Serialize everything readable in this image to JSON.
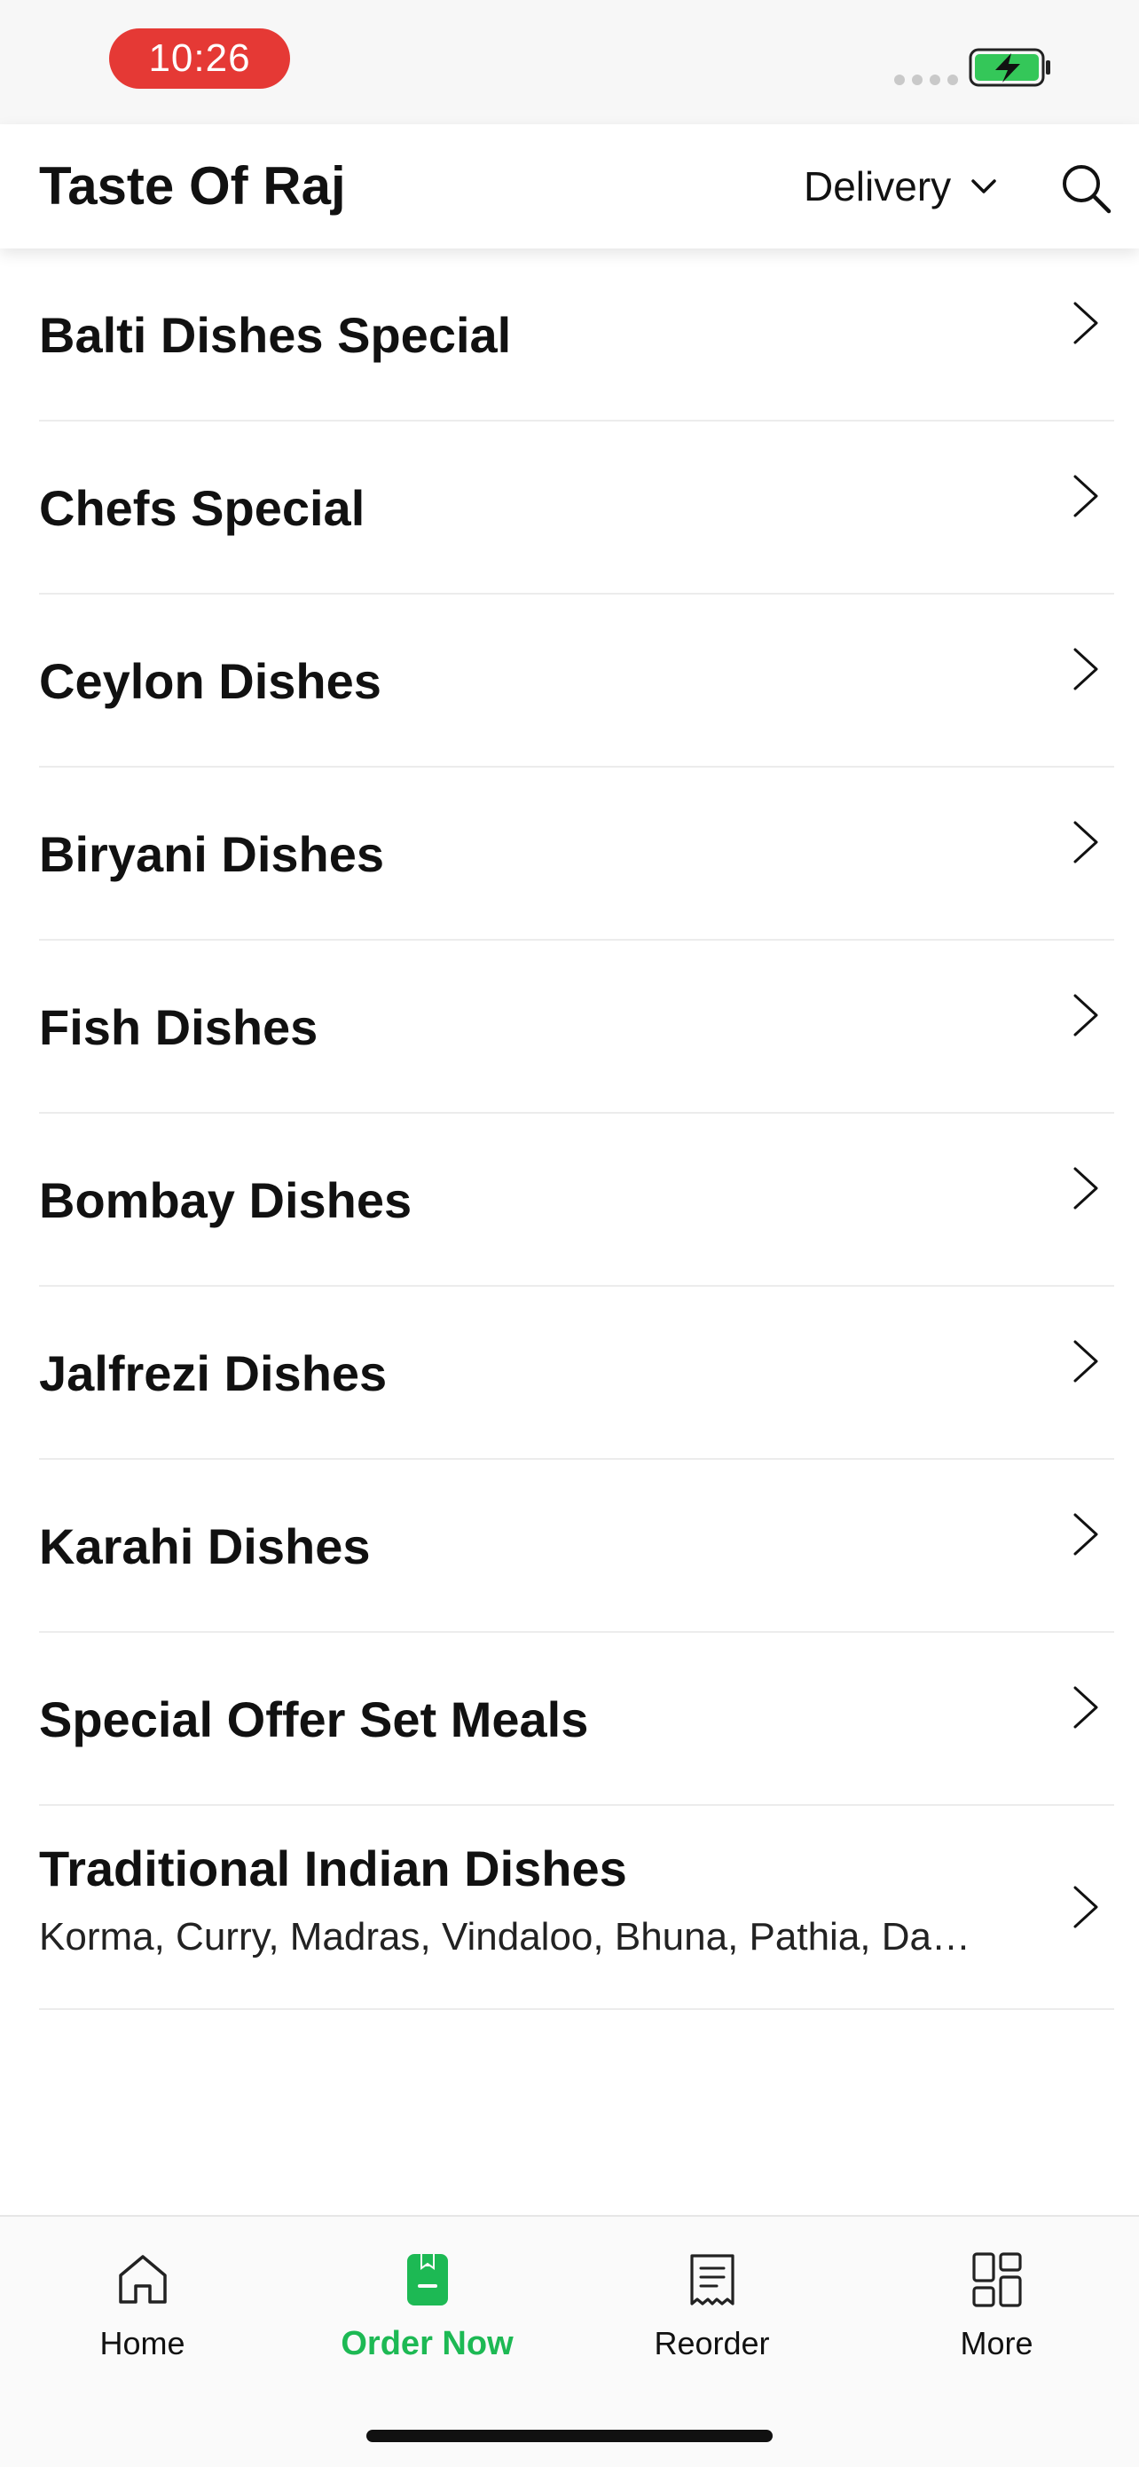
{
  "status_bar": {
    "time": "10:26"
  },
  "header": {
    "title": "Taste Of Raj",
    "mode_label": "Delivery"
  },
  "menu": {
    "items": [
      {
        "title": "Balti Dishes Special"
      },
      {
        "title": "Chefs Special"
      },
      {
        "title": "Ceylon Dishes"
      },
      {
        "title": "Biryani Dishes"
      },
      {
        "title": "Fish Dishes"
      },
      {
        "title": "Bombay Dishes"
      },
      {
        "title": "Jalfrezi Dishes"
      },
      {
        "title": "Karahi Dishes"
      },
      {
        "title": "Special Offer Set Meals"
      },
      {
        "title": "Traditional Indian Dishes",
        "subtitle": "Korma, Curry, Madras, Vindaloo, Bhuna, Pathia, Dans…"
      }
    ]
  },
  "tab_bar": {
    "tabs": [
      {
        "label": "Home",
        "icon": "home-icon"
      },
      {
        "label": "Order Now",
        "icon": "order-book-icon",
        "active": true
      },
      {
        "label": "Reorder",
        "icon": "receipt-icon"
      },
      {
        "label": "More",
        "icon": "grid-icon"
      }
    ]
  },
  "colors": {
    "accent": "#1db954",
    "status_pill": "#e53935",
    "battery": "#34c759"
  }
}
